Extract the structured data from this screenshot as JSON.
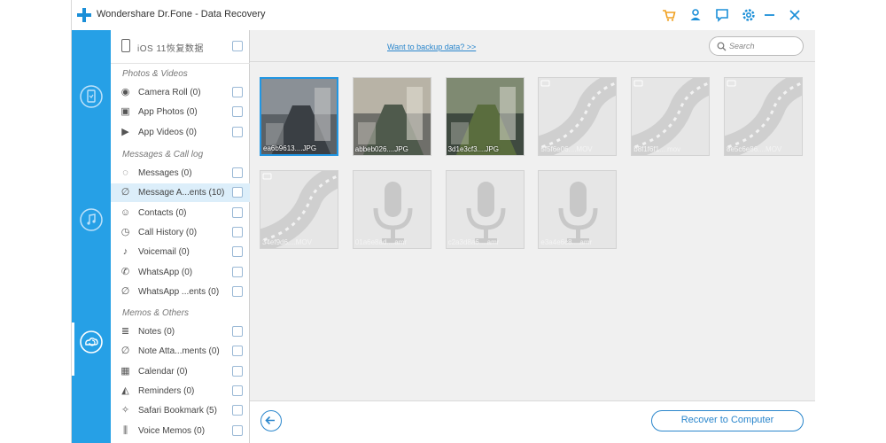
{
  "app": {
    "title": "Wondershare Dr.Fone - Data Recovery",
    "accent": "#26a0e6",
    "toolbar_icons": [
      "cart-icon",
      "user-icon",
      "feedback-icon",
      "gear-icon",
      "minimize-icon",
      "close-icon"
    ]
  },
  "device": {
    "name": "iOS 11恢复数据"
  },
  "sections": {
    "photos": "Photos & Videos",
    "messages": "Messages & Call log",
    "memos": "Memos & Others"
  },
  "items": [
    {
      "label": "Camera Roll (0)",
      "icon": "camera-icon"
    },
    {
      "label": "App Photos (0)",
      "icon": "image-icon"
    },
    {
      "label": "App Videos (0)",
      "icon": "video-icon"
    },
    {
      "label": "Messages (0)",
      "icon": "chat-icon"
    },
    {
      "label": "Message A...ents (10)",
      "icon": "paperclip-icon",
      "active": true
    },
    {
      "label": "Contacts (0)",
      "icon": "contact-icon"
    },
    {
      "label": "Call History (0)",
      "icon": "clock-icon"
    },
    {
      "label": "Voicemail (0)",
      "icon": "voicemail-icon"
    },
    {
      "label": "WhatsApp (0)",
      "icon": "whatsapp-icon"
    },
    {
      "label": "WhatsApp ...ents (0)",
      "icon": "paperclip-icon"
    },
    {
      "label": "Notes (0)",
      "icon": "notes-icon"
    },
    {
      "label": "Note Atta...ments (0)",
      "icon": "paperclip-icon"
    },
    {
      "label": "Calendar (0)",
      "icon": "calendar-icon"
    },
    {
      "label": "Reminders (0)",
      "icon": "bell-icon"
    },
    {
      "label": "Safari Bookmark (5)",
      "icon": "compass-icon"
    },
    {
      "label": "Voice Memos (0)",
      "icon": "waveform-icon"
    }
  ],
  "main": {
    "backup_link": "Want to backup data? >>",
    "search_placeholder": "Search",
    "recover_label": "Recover to Computer"
  },
  "files": [
    {
      "name": "ea6b9613....JPG",
      "kind": "photo",
      "selected": true
    },
    {
      "name": "abbeb026....JPG",
      "kind": "photo"
    },
    {
      "name": "3d1e3cf3....JPG",
      "kind": "photo"
    },
    {
      "name": "5f5f6e06....MOV",
      "kind": "video"
    },
    {
      "name": "b8f1f6f1....mov",
      "kind": "video"
    },
    {
      "name": "8e5c6e86....MOV",
      "kind": "video"
    },
    {
      "name": "34ef9d6....MOV",
      "kind": "video"
    },
    {
      "name": "01a6e8ad....amr",
      "kind": "audio"
    },
    {
      "name": "c2a3d8a6....amr",
      "kind": "audio"
    },
    {
      "name": "e3a4e6c8....amr",
      "kind": "audio"
    }
  ]
}
